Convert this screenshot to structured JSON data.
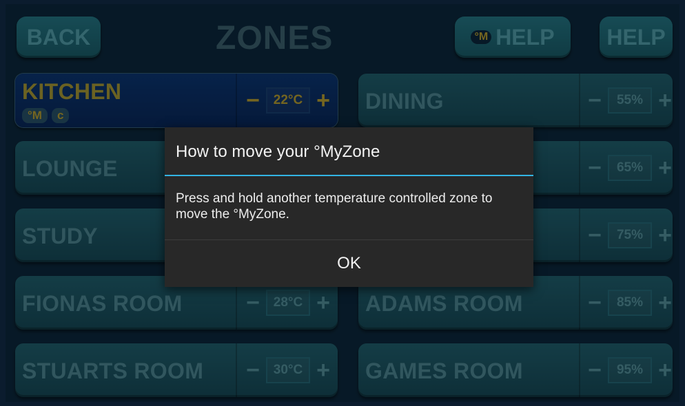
{
  "header": {
    "back_label": "BACK",
    "title": "ZONES",
    "myzone_help_badge": "°M",
    "myzone_help_label": "HELP",
    "help_label": "HELP"
  },
  "zones": [
    {
      "name": "KITCHEN",
      "value": "22°C",
      "active": true,
      "badges": [
        "°M",
        "c"
      ]
    },
    {
      "name": "DINING",
      "value": "55%"
    },
    {
      "name": "LOUNGE",
      "value": ""
    },
    {
      "name": "",
      "value": "65%"
    },
    {
      "name": "STUDY",
      "value": ""
    },
    {
      "name": "",
      "value": "75%"
    },
    {
      "name": "FIONAS ROOM",
      "value": "28°C"
    },
    {
      "name": "ADAMS ROOM",
      "value": "85%"
    },
    {
      "name": "STUARTS ROOM",
      "value": "30°C"
    },
    {
      "name": "GAMES ROOM",
      "value": "95%"
    }
  ],
  "controls": {
    "minus": "−",
    "plus": "+"
  },
  "dialog": {
    "title": "How to move your °MyZone",
    "message": "Press and hold another temperature controlled zone to move the °MyZone.",
    "ok_label": "OK"
  },
  "colors": {
    "accent_blue": "#33b5e5",
    "zone_teal": "#256f80",
    "active_zone_blue": "#0d3f86",
    "highlight_yellow": "#d4b83b"
  }
}
